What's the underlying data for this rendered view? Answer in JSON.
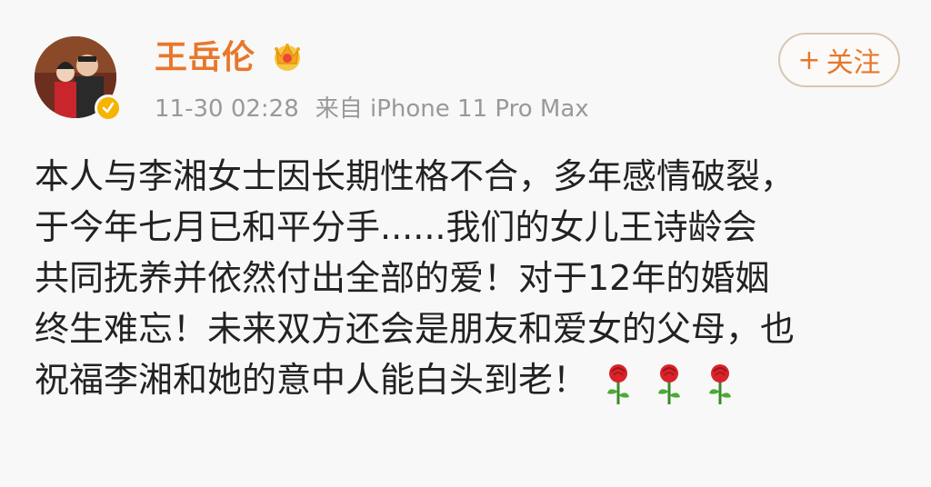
{
  "user": {
    "name": "王岳伦",
    "crown_icon": "crown-icon",
    "verified_icon": "verified-badge-icon",
    "avatar_icon": "avatar-photo"
  },
  "meta": {
    "time": "11-30 02:28",
    "source": "来自 iPhone 11 Pro Max"
  },
  "follow_button": {
    "plus": "+",
    "label": "关注"
  },
  "post": {
    "lines": [
      "本人与李湘女士因长期性格不合，多年感情破裂，",
      "于今年七月已和平分手......我们的女儿王诗龄会",
      "共同抚养并依然付出全部的爱！对于12年的婚姻",
      "终生难忘！未来双方还会是朋友和爱女的父母，也",
      "祝福李湘和她的意中人能白头到老！"
    ],
    "emoji": [
      "rose-icon",
      "rose-icon",
      "rose-icon"
    ]
  },
  "colors": {
    "accent": "#e8772a",
    "meta_text": "#999999",
    "body_text": "#222222",
    "background": "#f8f8f8",
    "verify": "#f5b400"
  }
}
